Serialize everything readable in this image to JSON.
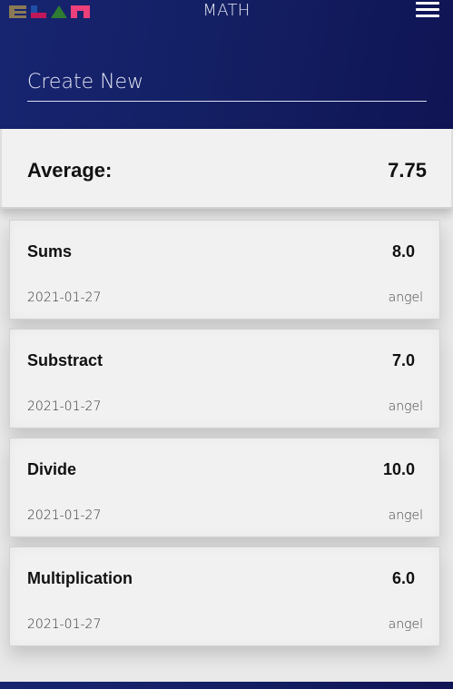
{
  "header": {
    "title": "MATH",
    "logo_colors": [
      "#8a7a55",
      "#1f4fa8",
      "#c2185b",
      "#2e7d32",
      "#ec407a"
    ],
    "menu_icon": "hamburger-icon"
  },
  "create": {
    "placeholder": "Create New"
  },
  "average": {
    "label": "Average:",
    "value": "7.75"
  },
  "scores": [
    {
      "name": "Sums",
      "value": "8.0",
      "date": "2021-01-27",
      "user": "angel"
    },
    {
      "name": "Substract",
      "value": "7.0",
      "date": "2021-01-27",
      "user": "angel"
    },
    {
      "name": "Divide",
      "value": "10.0",
      "date": "2021-01-27",
      "user": "angel"
    },
    {
      "name": "Multiplication",
      "value": "6.0",
      "date": "2021-01-27",
      "user": "angel"
    }
  ]
}
